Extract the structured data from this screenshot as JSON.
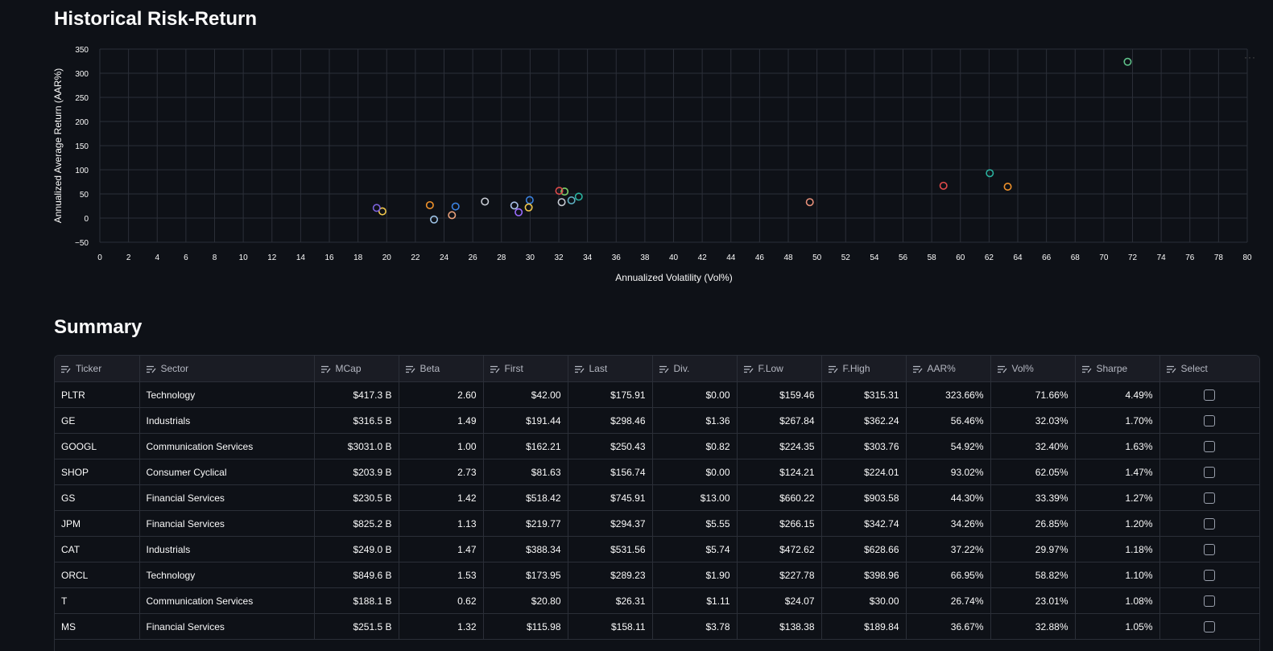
{
  "page": {
    "title": "Historical Risk-Return",
    "summary_title": "Summary"
  },
  "colors": {
    "background": "#0e1117",
    "grid": "#2b2f38",
    "text": "#fafafa",
    "muted": "#b5b8c2"
  },
  "chart_data": {
    "type": "scatter",
    "xlabel": "Annualized Volatility (Vol%)",
    "ylabel": "Annualized Average Return (AAR%)",
    "xlim": [
      0,
      80
    ],
    "ylim": [
      -50,
      350
    ],
    "xticks": [
      0,
      2,
      4,
      6,
      8,
      10,
      12,
      14,
      16,
      18,
      20,
      22,
      24,
      26,
      28,
      30,
      32,
      34,
      36,
      38,
      40,
      42,
      44,
      46,
      48,
      50,
      52,
      54,
      56,
      58,
      60,
      62,
      64,
      66,
      68,
      70,
      72,
      74,
      76,
      78,
      80
    ],
    "yticks": [
      -50,
      0,
      50,
      100,
      150,
      200,
      250,
      300,
      350
    ],
    "grid": true,
    "points": [
      {
        "x": 71.66,
        "y": 323.66,
        "color": "#5fc28a"
      },
      {
        "x": 62.05,
        "y": 93.02,
        "color": "#2bb3a0"
      },
      {
        "x": 58.82,
        "y": 66.95,
        "color": "#e04b4b"
      },
      {
        "x": 63.3,
        "y": 65.0,
        "color": "#f0922b"
      },
      {
        "x": 49.5,
        "y": 33.0,
        "color": "#e8907a"
      },
      {
        "x": 33.39,
        "y": 44.3,
        "color": "#2bb3a0"
      },
      {
        "x": 32.88,
        "y": 36.67,
        "color": "#5fb0c2"
      },
      {
        "x": 32.4,
        "y": 54.92,
        "color": "#7fd36b"
      },
      {
        "x": 32.03,
        "y": 56.46,
        "color": "#e04b4b"
      },
      {
        "x": 32.2,
        "y": 33.0,
        "color": "#c8ccd4"
      },
      {
        "x": 29.97,
        "y": 37.22,
        "color": "#3b82e0"
      },
      {
        "x": 29.9,
        "y": 22.0,
        "color": "#f2c94c"
      },
      {
        "x": 29.2,
        "y": 12.0,
        "color": "#9b6cff"
      },
      {
        "x": 28.9,
        "y": 26.0,
        "color": "#a9c1e8"
      },
      {
        "x": 26.85,
        "y": 34.26,
        "color": "#c8ccd4"
      },
      {
        "x": 24.8,
        "y": 24.0,
        "color": "#3b82e0"
      },
      {
        "x": 24.55,
        "y": 6.0,
        "color": "#e8a07a"
      },
      {
        "x": 23.3,
        "y": -3.0,
        "color": "#9ec3e6"
      },
      {
        "x": 23.01,
        "y": 26.74,
        "color": "#f0922b"
      },
      {
        "x": 19.7,
        "y": 14.0,
        "color": "#f2c94c"
      },
      {
        "x": 19.3,
        "y": 21.0,
        "color": "#7b61d9"
      }
    ]
  },
  "table": {
    "columns": [
      {
        "label": "Ticker",
        "align": "txt",
        "width": 105
      },
      {
        "label": "Sector",
        "align": "txt",
        "width": 217
      },
      {
        "label": "MCap",
        "align": "num",
        "width": 105
      },
      {
        "label": "Beta",
        "align": "num",
        "width": 105
      },
      {
        "label": "First",
        "align": "num",
        "width": 105
      },
      {
        "label": "Last",
        "align": "num",
        "width": 105
      },
      {
        "label": "Div.",
        "align": "num",
        "width": 105
      },
      {
        "label": "F.Low",
        "align": "num",
        "width": 105
      },
      {
        "label": "F.High",
        "align": "num",
        "width": 105
      },
      {
        "label": "AAR%",
        "align": "num",
        "width": 105
      },
      {
        "label": "Vol%",
        "align": "num",
        "width": 105
      },
      {
        "label": "Sharpe",
        "align": "num",
        "width": 105
      },
      {
        "label": "Select",
        "align": "chk",
        "width": 124
      }
    ],
    "rows": [
      [
        "PLTR",
        "Technology",
        "$417.3 B",
        "2.60",
        "$42.00",
        "$175.91",
        "$0.00",
        "$159.46",
        "$315.31",
        "323.66%",
        "71.66%",
        "4.49%"
      ],
      [
        "GE",
        "Industrials",
        "$316.5 B",
        "1.49",
        "$191.44",
        "$298.46",
        "$1.36",
        "$267.84",
        "$362.24",
        "56.46%",
        "32.03%",
        "1.70%"
      ],
      [
        "GOOGL",
        "Communication Services",
        "$3031.0 B",
        "1.00",
        "$162.21",
        "$250.43",
        "$0.82",
        "$224.35",
        "$303.76",
        "54.92%",
        "32.40%",
        "1.63%"
      ],
      [
        "SHOP",
        "Consumer Cyclical",
        "$203.9 B",
        "2.73",
        "$81.63",
        "$156.74",
        "$0.00",
        "$124.21",
        "$224.01",
        "93.02%",
        "62.05%",
        "1.47%"
      ],
      [
        "GS",
        "Financial Services",
        "$230.5 B",
        "1.42",
        "$518.42",
        "$745.91",
        "$13.00",
        "$660.22",
        "$903.58",
        "44.30%",
        "33.39%",
        "1.27%"
      ],
      [
        "JPM",
        "Financial Services",
        "$825.2 B",
        "1.13",
        "$219.77",
        "$294.37",
        "$5.55",
        "$266.15",
        "$342.74",
        "34.26%",
        "26.85%",
        "1.20%"
      ],
      [
        "CAT",
        "Industrials",
        "$249.0 B",
        "1.47",
        "$388.34",
        "$531.56",
        "$5.74",
        "$472.62",
        "$628.66",
        "37.22%",
        "29.97%",
        "1.18%"
      ],
      [
        "ORCL",
        "Technology",
        "$849.6 B",
        "1.53",
        "$173.95",
        "$289.23",
        "$1.90",
        "$227.78",
        "$398.96",
        "66.95%",
        "58.82%",
        "1.10%"
      ],
      [
        "T",
        "Communication Services",
        "$188.1 B",
        "0.62",
        "$20.80",
        "$26.31",
        "$1.11",
        "$24.07",
        "$30.00",
        "26.74%",
        "23.01%",
        "1.08%"
      ],
      [
        "MS",
        "Financial Services",
        "$251.5 B",
        "1.32",
        "$115.98",
        "$158.11",
        "$3.78",
        "$138.38",
        "$189.84",
        "36.67%",
        "32.88%",
        "1.05%"
      ]
    ]
  }
}
